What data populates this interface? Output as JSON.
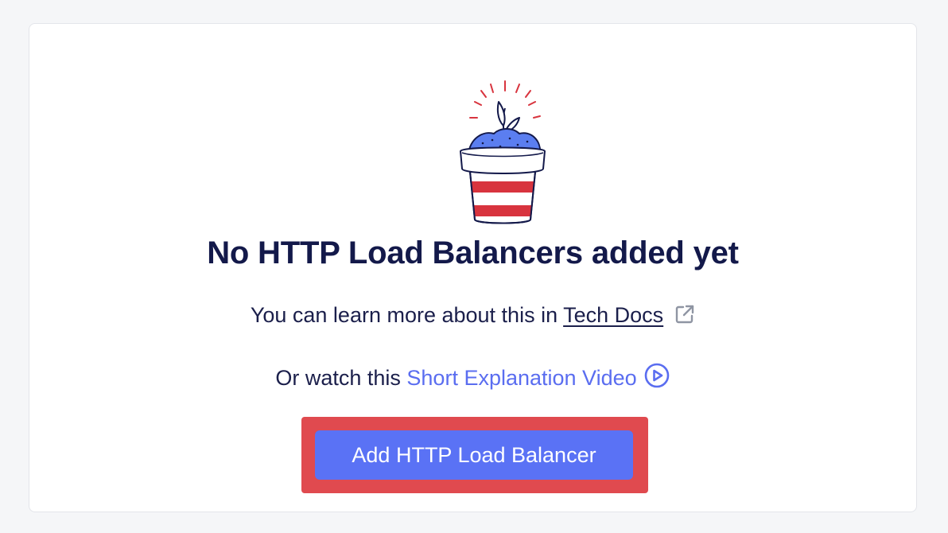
{
  "empty_state": {
    "title": "No HTTP Load Balancers added yet",
    "docs_prefix": "You can learn more about this in ",
    "docs_link": "Tech Docs",
    "video_prefix": "Or watch this ",
    "video_link": "Short Explanation Video",
    "add_button": "Add HTTP Load Balancer"
  },
  "icons": {
    "illustration": "plant-pot-icon",
    "docs_external": "external-link-icon",
    "video_play": "play-circle-icon"
  },
  "colors": {
    "title": "#13194a",
    "link_blue": "#5a6df0",
    "button_bg": "#5a72f5",
    "highlight_border": "#e04a4f",
    "pot_red": "#d8343e",
    "soil_blue": "#5b7ef0"
  }
}
